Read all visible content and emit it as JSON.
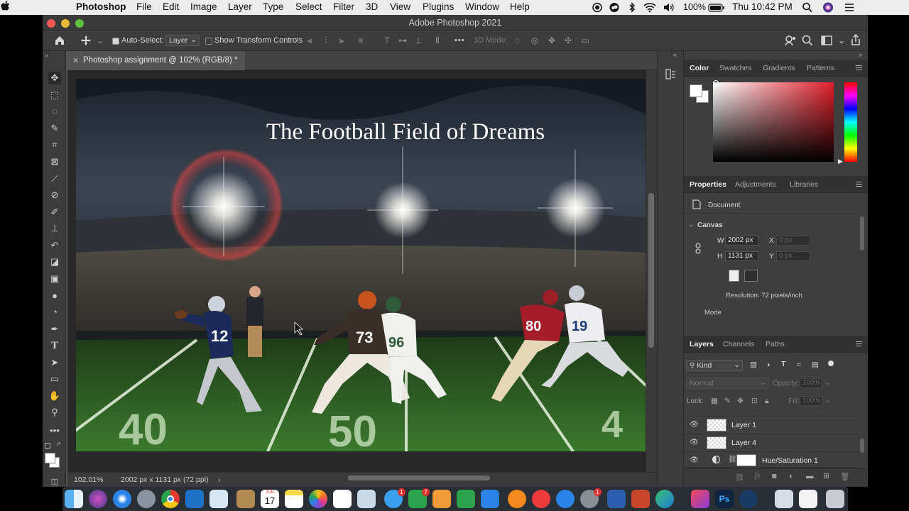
{
  "menubar": {
    "app_name": "Photoshop",
    "items": [
      "File",
      "Edit",
      "Image",
      "Layer",
      "Type",
      "Select",
      "Filter",
      "3D",
      "View",
      "Plugins",
      "Window",
      "Help"
    ],
    "battery": "100%",
    "clock": "Thu 10:42 PM",
    "status_icons": [
      "screen-record-icon",
      "creative-cloud-icon",
      "bluetooth-icon",
      "wifi-icon",
      "volume-icon",
      "battery-icon",
      "spotlight-icon",
      "siri-icon",
      "notification-center-icon"
    ]
  },
  "window": {
    "title": "Adobe Photoshop 2021"
  },
  "options_bar": {
    "auto_select_label": "Auto-Select:",
    "auto_select_checked": true,
    "auto_select_target": "Layer",
    "transform_controls_label": "Show Transform Controls",
    "transform_controls_checked": false,
    "mode_3d_label": "3D Mode:",
    "more_label": "•••"
  },
  "tools": [
    "move-tool-icon",
    "marquee-tool-icon",
    "lasso-tool-icon",
    "quick-select-tool-icon",
    "crop-tool-icon",
    "frame-tool-icon",
    "eyedropper-tool-icon",
    "healing-brush-icon",
    "brush-tool-icon",
    "clone-stamp-icon",
    "history-brush-icon",
    "eraser-tool-icon",
    "gradient-tool-icon",
    "blur-tool-icon",
    "dodge-tool-icon",
    "pen-tool-icon",
    "type-tool-icon",
    "path-select-tool-icon",
    "rectangle-tool-icon",
    "hand-tool-icon",
    "zoom-tool-icon",
    "more-tools-icon"
  ],
  "document": {
    "tab_label": "Photoshop assignment  @ 102% (RGB/8) *",
    "artwork_title": "The Football Field of Dreams",
    "field_numbers": [
      "40",
      "50",
      "4"
    ],
    "jersey_numbers": [
      "12",
      "73",
      "96",
      "80",
      "19"
    ],
    "zoom": "102.01%",
    "doc_info": "2002 px x 1131 px (72 ppi)"
  },
  "color_panel": {
    "tabs": [
      "Color",
      "Swatches",
      "Gradients",
      "Patterns"
    ],
    "active_tab": "Color",
    "foreground": "#ffffff",
    "background": "#ffffff",
    "hue_color": "#e21f2b"
  },
  "properties_panel": {
    "tabs": [
      "Properties",
      "Adjustments",
      "Libraries"
    ],
    "active_tab": "Properties",
    "doc_label": "Document",
    "section": "Canvas",
    "width_label": "W",
    "width": "2002 px",
    "height_label": "H",
    "height": "1131 px",
    "x_label": "X",
    "x_value": "0 px",
    "y_label": "Y",
    "y_value": "0 px",
    "resolution": "Resolution: 72 pixels/inch",
    "mode_label": "Mode"
  },
  "layers_panel": {
    "tabs": [
      "Layers",
      "Channels",
      "Paths"
    ],
    "active_tab": "Layers",
    "filter_kind": "Kind",
    "blend_mode": "Normal",
    "opacity_label": "Opacity:",
    "opacity": "100%",
    "lock_label": "Lock:",
    "fill_label": "Fill:",
    "fill": "100%",
    "layers": [
      {
        "name": "Layer 1",
        "visible": true
      },
      {
        "name": "Layer 4",
        "visible": true
      },
      {
        "name": "Hue/Saturation 1",
        "visible": true
      }
    ]
  },
  "dock": {
    "apps": [
      "finder-icon",
      "siri-icon",
      "safari-icon",
      "launchpad-icon",
      "chrome-icon",
      "vscode-icon",
      "preview-icon",
      "contacts-icon",
      "calendar-icon",
      "notes-icon",
      "photos-icon",
      "reminders-icon",
      "preview-image-icon",
      "messages-icon",
      "facetime-icon",
      "pages-icon",
      "numbers-icon",
      "keynote-icon",
      "books-icon",
      "news-icon",
      "app-store-icon",
      "system-preferences-icon",
      "word-icon",
      "powerpoint-icon",
      "edge-icon",
      "creative-cloud-icon",
      "photoshop-icon",
      "quicktime-icon",
      "screenshot-icon",
      "document-icon",
      "trash-icon"
    ],
    "calendar_month": "JUN",
    "calendar_day": "17",
    "messages_badge": "1",
    "facetime_badge": "7",
    "sysprefs_badge": "1"
  }
}
